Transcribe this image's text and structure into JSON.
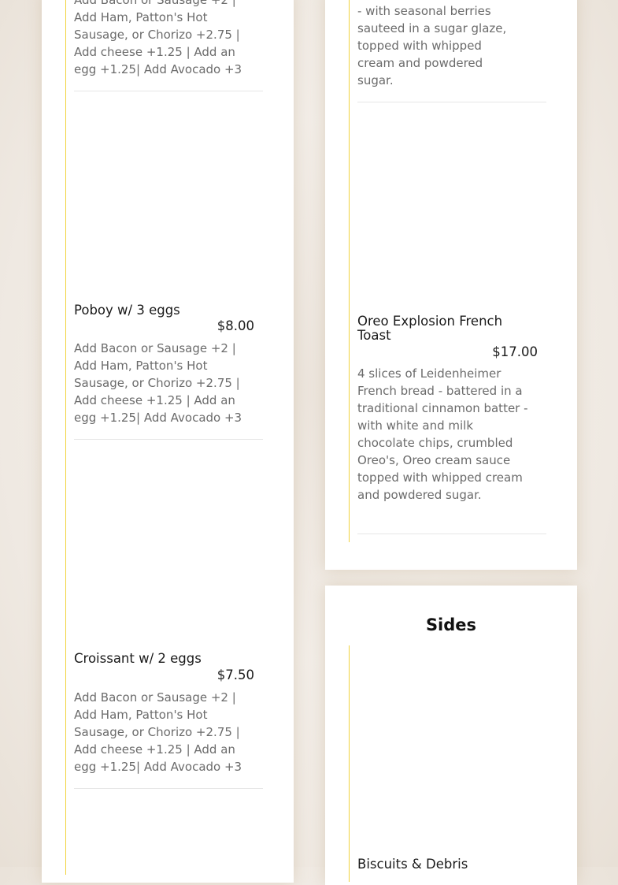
{
  "left_column": {
    "items": [
      {
        "name": "",
        "price": "",
        "description": "Add Bacon or Sausage +2 | Add Ham, Patton's Hot Sausage, or Chorizo +2.75 | Add cheese +1.25 | Add an egg +1.25| Add Avocado +3"
      },
      {
        "name": "Poboy w/ 3 eggs",
        "price": "$8.00",
        "description": "Add Bacon or Sausage +2 | Add Ham, Patton's Hot Sausage, or Chorizo +2.75 | Add cheese +1.25 | Add an egg +1.25| Add Avocado +3"
      },
      {
        "name": "Croissant w/ 2 eggs",
        "price": "$7.50",
        "description": "Add Bacon or Sausage +2 | Add Ham, Patton's Hot Sausage, or Chorizo +2.75 | Add cheese +1.25 | Add an egg +1.25| Add Avocado +3"
      }
    ]
  },
  "right_column": {
    "items": [
      {
        "name": "",
        "price": "",
        "description": "- with seasonal berries sauteed in a sugar glaze, topped with whipped cream and powdered sugar."
      },
      {
        "name": "Oreo Explosion French Toast",
        "price": "$17.00",
        "description": "4 slices of Leidenheimer French bread - battered in a traditional cinnamon batter - with white and milk chocolate chips, crumbled Oreo's, Oreo cream sauce topped with whipped cream and powdered sugar."
      }
    ],
    "sides_section": {
      "title": "Sides",
      "items": [
        {
          "name": "Biscuits & Debris"
        }
      ]
    }
  },
  "colors": {
    "accent_rail": "#f0d23c",
    "card_background": "#ffffff",
    "page_background": "#efe9e2"
  }
}
